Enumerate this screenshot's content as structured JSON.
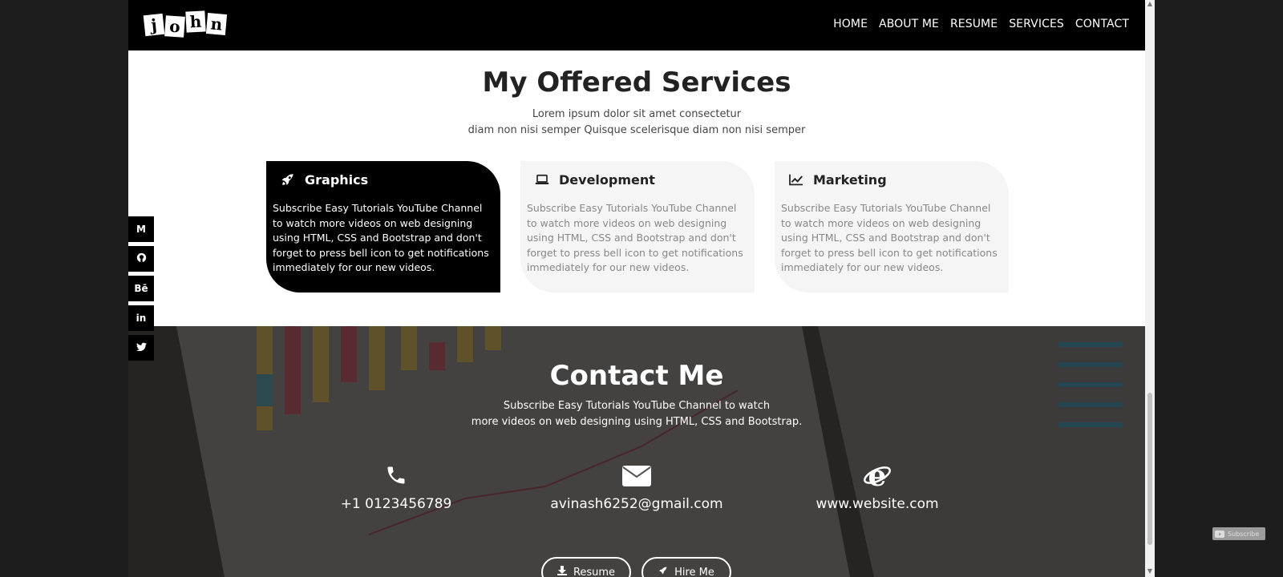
{
  "header": {
    "logo_letters": [
      "j",
      "o",
      "h",
      "n"
    ],
    "nav": [
      "HOME",
      "ABOUT ME",
      "RESUME",
      "SERVICES",
      "CONTACT"
    ]
  },
  "services": {
    "title": "My Offered Services",
    "subtitle_line1": "Lorem ipsum dolor sit amet consectetur",
    "subtitle_line2": "diam non nisi semper Quisque scelerisque diam non nisi semper",
    "cards": [
      {
        "icon": "rocket-icon",
        "title": "Graphics",
        "text": "Subscribe Easy Tutorials YouTube Channel to watch more videos on web designing using HTML, CSS and Bootstrap and don't forget to press bell icon to get notifications immediately for our new videos.",
        "active": true
      },
      {
        "icon": "laptop-icon",
        "title": "Development",
        "text": "Subscribe Easy Tutorials YouTube Channel to watch more videos on web designing using HTML, CSS and Bootstrap and don't forget to press bell icon to get notifications immediately for our new videos.",
        "active": false
      },
      {
        "icon": "line-chart-icon",
        "title": "Marketing",
        "text": "Subscribe Easy Tutorials YouTube Channel to watch more videos on web designing using HTML, CSS and Bootstrap and don't forget to press bell icon to get notifications immediately for our new videos.",
        "active": false
      }
    ]
  },
  "social": [
    {
      "icon": "medium-icon",
      "glyph": "M"
    },
    {
      "icon": "github-icon",
      "glyph": ""
    },
    {
      "icon": "behance-icon",
      "glyph": "Bē"
    },
    {
      "icon": "linkedin-icon",
      "glyph": "in"
    },
    {
      "icon": "twitter-icon",
      "glyph": ""
    }
  ],
  "contact": {
    "title": "Contact Me",
    "subtitle_line1": "Subscribe Easy Tutorials YouTube Channel to watch",
    "subtitle_line2": "more videos on web designing using HTML, CSS and Bootstrap.",
    "phone": "+1 0123456789",
    "email": "avinash6252@gmail.com",
    "website": "www.website.com",
    "resume_button": "Resume",
    "hire_button": "Hire Me"
  },
  "overlay": {
    "subscribe": "Subscribe"
  },
  "colors": {
    "header_bg": "#000000",
    "active_card_bg": "#000000",
    "inactive_card_bg": "#f5f5f5",
    "text_muted": "#888888"
  }
}
